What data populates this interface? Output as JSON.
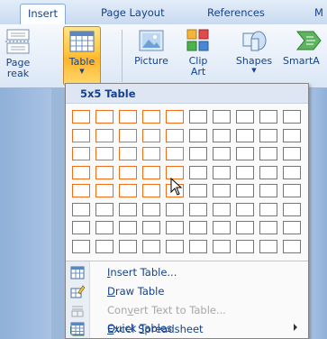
{
  "tabs": [
    {
      "label": "Insert",
      "active": true
    },
    {
      "label": "Page Layout",
      "active": false
    },
    {
      "label": "References",
      "active": false
    },
    {
      "label": "M",
      "active": false
    }
  ],
  "ribbon": {
    "page_break": {
      "line1": "Page",
      "line2": "reak"
    },
    "table": {
      "label": "Table"
    },
    "picture": {
      "label": "Picture"
    },
    "clip_art": {
      "line1": "Clip",
      "line2": "Art"
    },
    "shapes": {
      "label": "Shapes"
    },
    "smartart": {
      "label": "SmartA"
    }
  },
  "table_menu": {
    "title": "5x5 Table",
    "grid": {
      "columns": 10,
      "rows": 8,
      "selected_columns": 5,
      "selected_rows": 5
    },
    "items": [
      {
        "pre": "",
        "key": "I",
        "post": "nsert Table...",
        "icon": "insert-table-icon",
        "disabled": false,
        "submenu": false
      },
      {
        "pre": "",
        "key": "D",
        "post": "raw Table",
        "icon": "draw-table-icon",
        "disabled": false,
        "submenu": false
      },
      {
        "pre": "Con",
        "key": "v",
        "post": "ert Text to Table...",
        "icon": "convert-text-icon",
        "disabled": true,
        "submenu": false
      },
      {
        "pre": "",
        "key": "E",
        "post": "xcel Spreadsheet",
        "icon": "excel-icon",
        "disabled": false,
        "submenu": false
      },
      {
        "pre": "Quick ",
        "key": "T",
        "post": "ables",
        "icon": "quick-tables-icon",
        "disabled": false,
        "submenu": true
      }
    ]
  },
  "colors": {
    "selected_cell_border": "#f06d1a",
    "cell_border": "#777777",
    "active_button": "#ffc53c"
  }
}
